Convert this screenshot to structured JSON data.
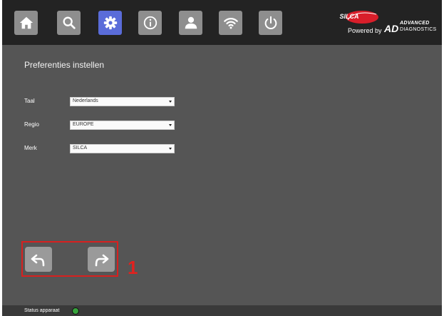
{
  "toolbar": {
    "icons": [
      "home-icon",
      "search-icon",
      "gear-icon",
      "info-icon",
      "user-icon",
      "wifi-icon",
      "power-icon"
    ],
    "active": "gear-icon",
    "active_color": "#5a6cd9"
  },
  "brand": {
    "logo_text": "SILCA",
    "powered_by": "Powered by",
    "ad_mark": "AD",
    "advanced": "ADVANCED",
    "diagnostics": "DIAGNOSTICS",
    "logo_color": "#d81e2a"
  },
  "page": {
    "title": "Preferenties instellen"
  },
  "fields": {
    "language": {
      "label": "Taal",
      "value": "Nederlands"
    },
    "region": {
      "label": "Regio",
      "value": "EUROPE"
    },
    "brand": {
      "label": "Merk",
      "value": "SILCA"
    }
  },
  "navigation": {
    "back_icon": "undo-arrow-icon",
    "forward_icon": "redo-arrow-icon",
    "annotation": "1",
    "annotation_color": "#e0221f"
  },
  "status": {
    "label": "Status apparaat",
    "indicator_color": "#36a33b"
  }
}
